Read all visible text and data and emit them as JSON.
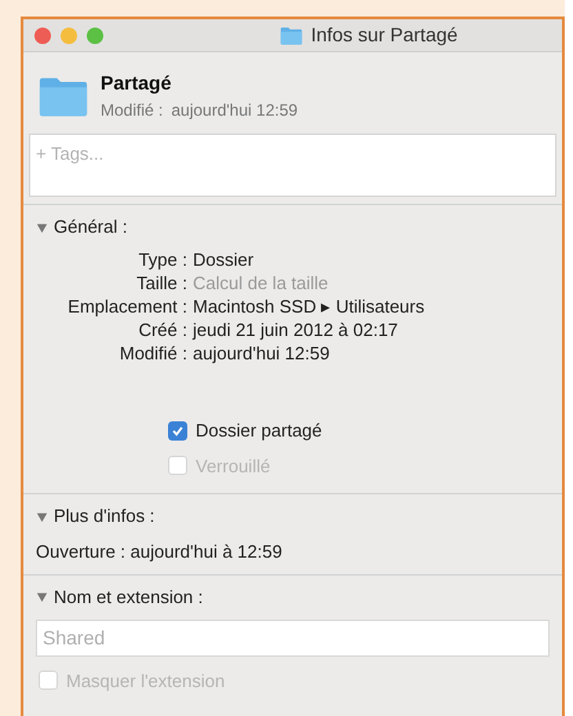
{
  "window": {
    "title": "Infos sur Partagé"
  },
  "header": {
    "name": "Partagé",
    "modified_label": "Modifié :",
    "modified_value": "aujourd'hui 12:59"
  },
  "tags": {
    "placeholder": "+ Tags..."
  },
  "general": {
    "title": "Général :",
    "expanded": true,
    "rows": [
      {
        "label": "Type :",
        "value": "Dossier",
        "dimmed": false
      },
      {
        "label": "Taille :",
        "value": "Calcul de la taille",
        "dimmed": true
      },
      {
        "label": "Emplacement :",
        "value": "Macintosh SSD ▸ Utilisateurs",
        "dimmed": false
      },
      {
        "label": "Créé :",
        "value": "jeudi 21 juin 2012 à 02:17",
        "dimmed": false
      },
      {
        "label": "Modifié :",
        "value": "aujourd'hui 12:59",
        "dimmed": false
      }
    ],
    "checkboxes": [
      {
        "label": "Dossier partagé",
        "checked": true,
        "disabled": false
      },
      {
        "label": "Verrouillé",
        "checked": false,
        "disabled": true
      }
    ]
  },
  "more_info": {
    "title": "Plus d'infos :",
    "expanded": true,
    "text": "Ouverture : aujourd'hui à 12:59"
  },
  "name_extension": {
    "title": "Nom et extension :",
    "expanded": true,
    "name_value": "Shared",
    "name_disabled": true,
    "checkbox": {
      "label": "Masquer l'extension",
      "checked": false,
      "disabled": true
    }
  }
}
